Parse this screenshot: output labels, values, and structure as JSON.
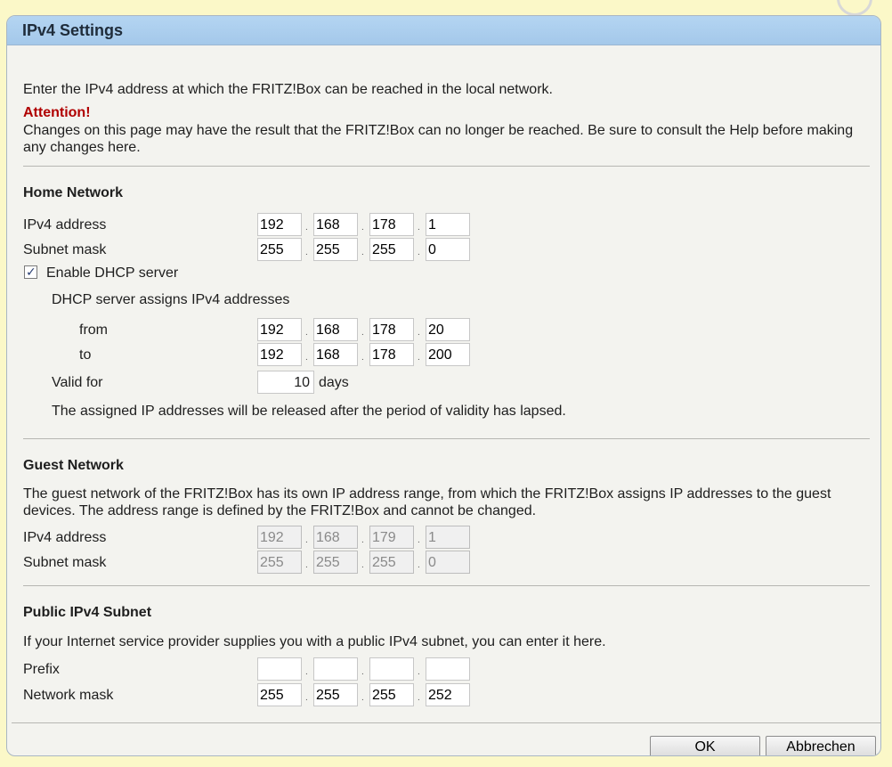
{
  "panel": {
    "title": "IPv4 Settings"
  },
  "intro": {
    "text": "Enter the IPv4 address at which the FRITZ!Box can be reached in the local network.",
    "attention_label": "Attention!",
    "attention_line1": "Changes on this page may have the result that the FRITZ!Box can no longer be reached. Be sure to consult the Help before making",
    "attention_line2": "any changes here."
  },
  "home": {
    "heading": "Home Network",
    "ipv4_label": "IPv4 address",
    "ipv4": [
      "192",
      "168",
      "178",
      "1"
    ],
    "subnet_label": "Subnet mask",
    "subnet": [
      "255",
      "255",
      "255",
      "0"
    ],
    "dhcp_enable_label": "Enable DHCP server",
    "dhcp_enabled": true,
    "dhcp_assigns_label": "DHCP server assigns IPv4 addresses",
    "from_label": "from",
    "from": [
      "192",
      "168",
      "178",
      "20"
    ],
    "to_label": "to",
    "to": [
      "192",
      "168",
      "178",
      "200"
    ],
    "valid_label": "Valid for",
    "valid_value": "10",
    "valid_unit": "days",
    "release_note": "The assigned IP addresses will be released after the period of validity has lapsed."
  },
  "guest": {
    "heading": "Guest Network",
    "desc_line1": "The guest network of the FRITZ!Box has its own IP address range, from which the FRITZ!Box assigns IP addresses to the guest",
    "desc_line2": "devices. The address range is defined by the FRITZ!Box and cannot be changed.",
    "ipv4_label": "IPv4 address",
    "ipv4": [
      "192",
      "168",
      "179",
      "1"
    ],
    "subnet_label": "Subnet mask",
    "subnet": [
      "255",
      "255",
      "255",
      "0"
    ]
  },
  "public": {
    "heading": "Public IPv4 Subnet",
    "desc": "If your Internet service provider supplies you with a public IPv4 subnet, you can enter it here.",
    "prefix_label": "Prefix",
    "prefix": [
      "",
      "",
      "",
      ""
    ],
    "netmask_label": "Network mask",
    "netmask": [
      "255",
      "255",
      "255",
      "252"
    ]
  },
  "buttons": {
    "ok": "OK",
    "cancel": "Abbrechen"
  },
  "colors": {
    "attention": "#b00000",
    "header": "#a4c8ea",
    "background": "#fbf8c8"
  }
}
